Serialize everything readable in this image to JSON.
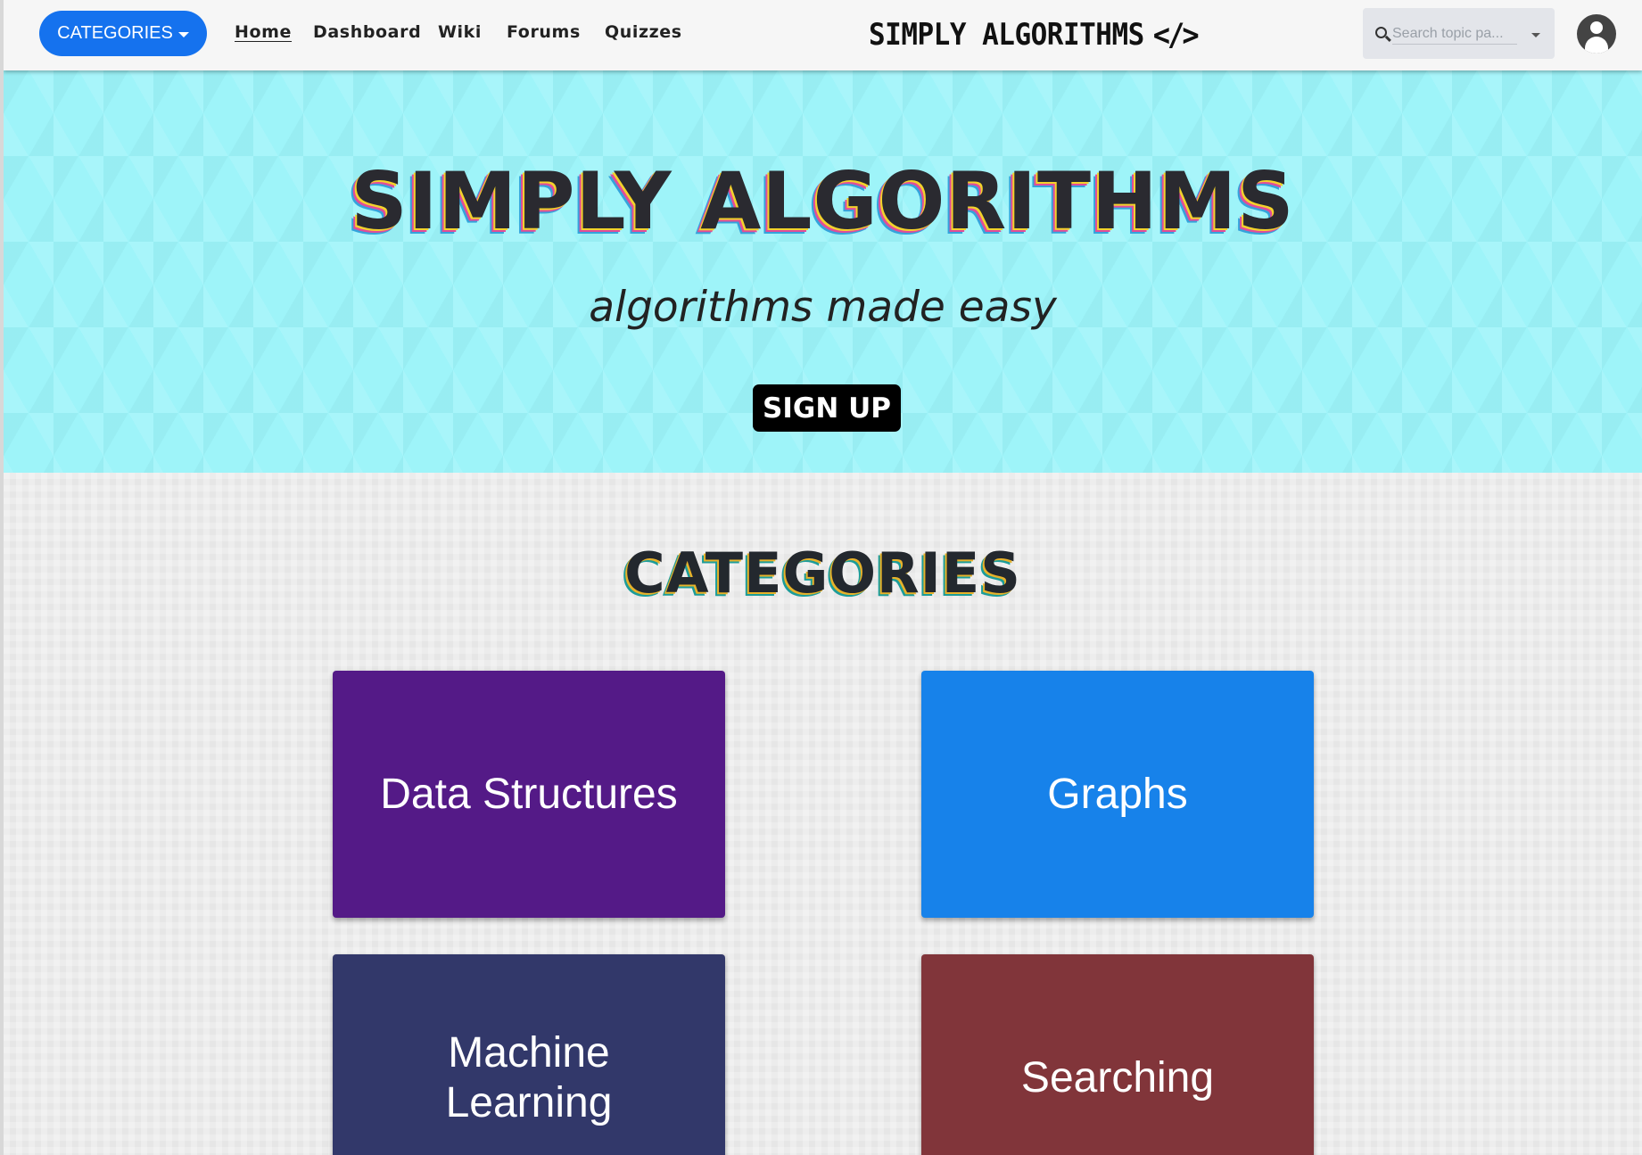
{
  "navbar": {
    "categories_button": "CATEGORIES",
    "links": [
      "Home",
      "Dashboard",
      "Wiki",
      "Forums",
      "Quizzes"
    ],
    "active_link": "Home",
    "brand": "SIMPLY ALGORITHMS",
    "brand_icon": "code-brackets-icon",
    "brand_icon_text": "</>",
    "search_placeholder": "Search topic pa...",
    "account_icon": "account-circle-icon"
  },
  "hero": {
    "title": "SIMPLY ALGORITHMS",
    "subtitle": "algorithms made easy",
    "signup_button": "SIGN UP",
    "background_color": "#9ef4f9"
  },
  "categories": {
    "title": "CATEGORIES",
    "cards": [
      {
        "label": "Data Structures",
        "color": "#541a87"
      },
      {
        "label": "Graphs",
        "color": "#1782ea"
      },
      {
        "label": "Machine Learning",
        "color": "#32386a"
      },
      {
        "label": "Searching",
        "color": "#81353a"
      }
    ]
  },
  "colors": {
    "accent": "#1572ee",
    "navbar": "#f6f6f6"
  }
}
